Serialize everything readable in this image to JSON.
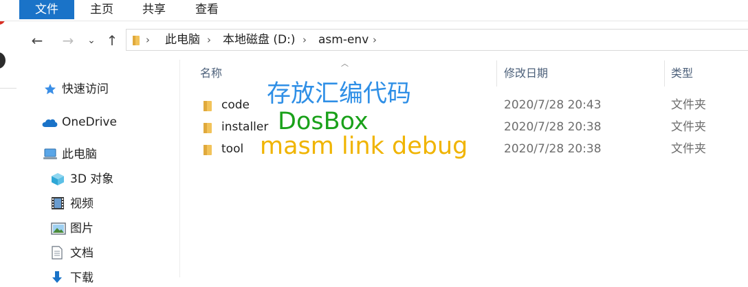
{
  "ribbon": {
    "tabs": [
      {
        "label": "文件",
        "active": true
      },
      {
        "label": "主页",
        "active": false
      },
      {
        "label": "共享",
        "active": false
      },
      {
        "label": "查看",
        "active": false
      }
    ]
  },
  "nav": {
    "back": "←",
    "forward": "→",
    "recent": "⌄",
    "up": "↑"
  },
  "address": {
    "segments": [
      "此电脑",
      "本地磁盘 (D:)",
      "asm-env"
    ],
    "separator": "›"
  },
  "sidebar": {
    "items": [
      {
        "label": "快速访问",
        "icon": "star-icon"
      },
      {
        "label": "OneDrive",
        "icon": "cloud-icon"
      },
      {
        "label": "此电脑",
        "icon": "computer-icon"
      },
      {
        "label": "3D 对象",
        "icon": "cube-icon"
      },
      {
        "label": "视频",
        "icon": "film-icon"
      },
      {
        "label": "图片",
        "icon": "picture-icon"
      },
      {
        "label": "文档",
        "icon": "document-icon"
      },
      {
        "label": "下载",
        "icon": "download-icon"
      }
    ]
  },
  "columns": {
    "name": "名称",
    "modified": "修改日期",
    "type": "类型"
  },
  "files": [
    {
      "name": "code",
      "modified": "2020/7/28 20:43",
      "type": "文件夹"
    },
    {
      "name": "installer",
      "modified": "2020/7/28 20:38",
      "type": "文件夹"
    },
    {
      "name": "tool",
      "modified": "2020/7/28 20:38",
      "type": "文件夹"
    }
  ],
  "annotations": [
    {
      "text": "存放汇编代码",
      "color": "#2f8fe6"
    },
    {
      "text": "DosBox",
      "color": "#1aa11a"
    },
    {
      "text": "masm link debug",
      "color": "#f0b400"
    }
  ],
  "colors": {
    "accent": "#1a73c8",
    "folder": "#f2c35a",
    "header_text": "#4c607a"
  }
}
